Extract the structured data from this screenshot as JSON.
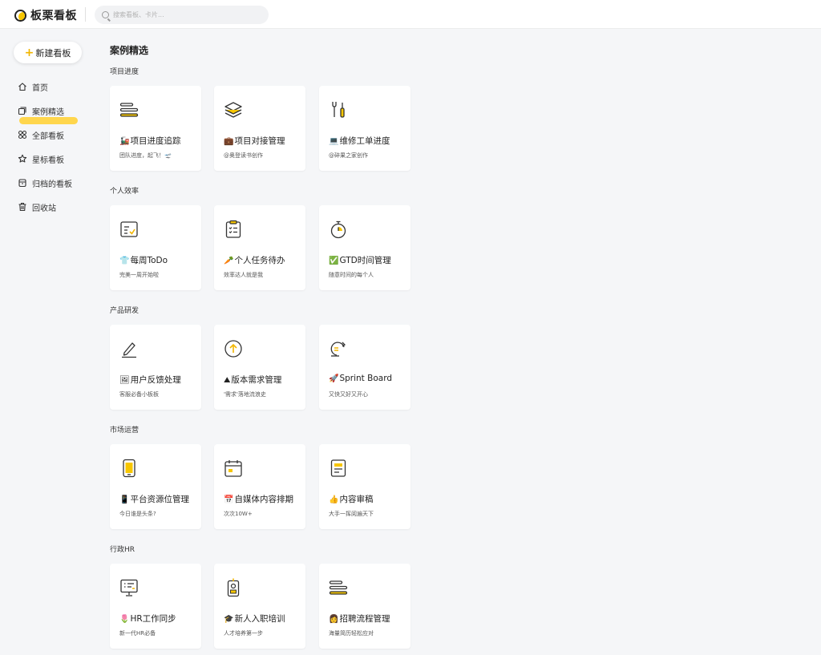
{
  "app": {
    "name": "板栗看板"
  },
  "search": {
    "placeholder": "搜索看板、卡片..."
  },
  "new_board_label": "新建看板",
  "nav": [
    {
      "icon": "home-icon",
      "label": "首页"
    },
    {
      "icon": "board-stack-icon",
      "label": "案例精选",
      "active": true
    },
    {
      "icon": "grid-icon",
      "label": "全部看板"
    },
    {
      "icon": "star-icon",
      "label": "星标看板"
    },
    {
      "icon": "archive-icon",
      "label": "归档的看板"
    },
    {
      "icon": "trash-icon",
      "label": "回收站"
    }
  ],
  "section_title": "案例精选",
  "groups": [
    {
      "title": "项目进度",
      "cards": [
        {
          "icon": "progress-bars-icon",
          "emoji": "🚂",
          "title": "项目进度追踪",
          "subtitle": "团队进度，起飞！🛫"
        },
        {
          "icon": "layers-icon",
          "emoji": "💼",
          "title": "项目对接管理",
          "subtitle": "@奥登读书创作"
        },
        {
          "icon": "tools-icon",
          "emoji": "💻",
          "title": "维修工单进度",
          "subtitle": "@碎果之家创作"
        }
      ]
    },
    {
      "title": "个人效率",
      "cards": [
        {
          "icon": "checklist-icon",
          "emoji": "👕",
          "title": "每周ToDo",
          "subtitle": "完美一周开始啦"
        },
        {
          "icon": "clipboard-icon",
          "emoji": "🥕",
          "title": "个人任务待办",
          "subtitle": "效率达人就是我"
        },
        {
          "icon": "stopwatch-icon",
          "emoji": "✅",
          "title": "GTD时间管理",
          "subtitle": "随意时间的每个人"
        }
      ]
    },
    {
      "title": "产品研发",
      "cards": [
        {
          "icon": "pen-icon",
          "emoji": "🖼",
          "title": "用户反馈处理",
          "subtitle": "客服必备小板板"
        },
        {
          "icon": "upload-circle-icon",
          "emoji": "⛰",
          "title": "版本需求管理",
          "subtitle": "'需求'落地流浪史"
        },
        {
          "icon": "sprint-icon",
          "emoji": "🚀",
          "title": "Sprint Board",
          "subtitle": "又快又好又开心"
        }
      ]
    },
    {
      "title": "市场运营",
      "cards": [
        {
          "icon": "phone-icon",
          "emoji": "📱",
          "title": "平台资源位管理",
          "subtitle": "今日谁是头条?"
        },
        {
          "icon": "calendar-icon",
          "emoji": "📅",
          "title": "自媒体内容排期",
          "subtitle": "次次10W+"
        },
        {
          "icon": "document-icon",
          "emoji": "👍",
          "title": "内容审稿",
          "subtitle": "大手一挥阅遍天下"
        }
      ]
    },
    {
      "title": "行政HR",
      "cards": [
        {
          "icon": "presentation-icon",
          "emoji": "🌷",
          "title": "HR工作同步",
          "subtitle": "新一代HR必备"
        },
        {
          "icon": "badge-icon",
          "emoji": "🎓",
          "title": "新人入职培训",
          "subtitle": "人才培养第一步"
        },
        {
          "icon": "progress-bars-icon",
          "emoji": "👩",
          "title": "招聘流程管理",
          "subtitle": "海量简历轻松应对"
        }
      ]
    }
  ],
  "colors": {
    "accent": "#f7c600",
    "highlight": "#ffd64d",
    "background": "#f5f6f8"
  }
}
